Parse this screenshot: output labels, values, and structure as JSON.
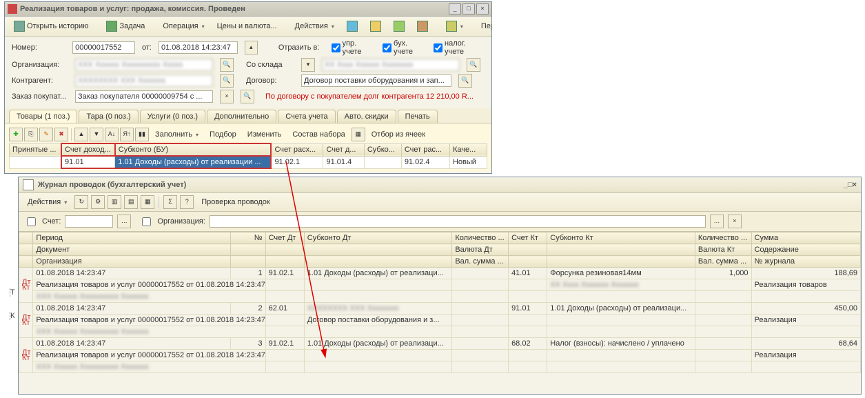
{
  "win1": {
    "title": "Реализация товаров и услуг: продажа, комиссия. Проведен",
    "tb": {
      "history": "Открыть историю",
      "task": "Задача",
      "operation": "Операция",
      "prices": "Цены и валюта...",
      "actions": "Действия",
      "goto": "Перейти"
    },
    "fields": {
      "number_lbl": "Номер:",
      "number": "00000017552",
      "from_lbl": "от:",
      "date": "01.08.2018 14:23:47",
      "reflect_lbl": "Отразить в:",
      "chk1": "упр. учете",
      "chk2": "бух. учете",
      "chk3": "налог. учете",
      "org_lbl": "Организация:",
      "warehouse_lbl": "Со склада",
      "contr_lbl": "Контрагент:",
      "contract_lbl": "Договор:",
      "contract": "Договор поставки оборудования и зап...",
      "order_lbl": "Заказ покупат...",
      "order": "Заказ покупателя 00000009754 с ...",
      "debt_note": "По договору с покупателем долг контрагента 12 210,00 R..."
    },
    "tabs": [
      "Товары (1 поз.)",
      "Тара (0 поз.)",
      "Услуги (0 поз.)",
      "Дополнительно",
      "Счета учета",
      "Авто. скидки",
      "Печать"
    ],
    "gtb": {
      "fill": "Заполнить",
      "select": "Подбор",
      "change": "Изменить",
      "bundle": "Состав набора",
      "cellfilter": "Отбор из ячеек"
    },
    "grid": {
      "headers": [
        "Принятые ...",
        "Счет доход...",
        "Субконто (БУ)",
        "Счет расх...",
        "Счет д...",
        "Субко...",
        "Счет рас...",
        "Каче..."
      ],
      "row": [
        "",
        "91.01",
        "1.01 Доходы (расходы) от реализации ...",
        "91.02.1",
        "91.01.4",
        "",
        "91.02.4",
        "Новый"
      ]
    }
  },
  "win2": {
    "title": "Журнал проводок (бухгалтерский учет)",
    "tb": {
      "actions": "Действия",
      "check": "Проверка проводок"
    },
    "filter": {
      "acct_lbl": "Счет:",
      "org_lbl": "Организация:"
    },
    "headers1": [
      "",
      "Период",
      "№",
      "Счет Дт",
      "Субконто Дт",
      "Количество ...",
      "Счет Кт",
      "Субконто Кт",
      "Количество ...",
      "Сумма"
    ],
    "headers2": [
      "",
      "Документ",
      "",
      "",
      "",
      "Валюта Дт",
      "",
      "",
      "Валюта Кт",
      "Содержание"
    ],
    "headers3": [
      "",
      "Организация",
      "",
      "",
      "",
      "Вал. сумма ...",
      "",
      "",
      "Вал. сумма ...",
      "№ журнала"
    ],
    "rows": [
      {
        "period": "01.08.2018 14:23:47",
        "n": "1",
        "dt": "91.02.1",
        "sdt": "1.01 Доходы (расходы) от реализаци...",
        "qdt": "",
        "kt": "41.01",
        "skt": "Форсунка  резиновая14мм",
        "qkt": "1,000",
        "sum": "188,69",
        "doc": "Реализация товаров и услуг 00000017552 от 01.08.2018 14:23:47",
        "cont": "Реализация товаров"
      },
      {
        "period": "01.08.2018 14:23:47",
        "n": "2",
        "dt": "62.01",
        "sdt": "[blur]",
        "qdt": "",
        "kt": "91.01",
        "skt": "1.01 Доходы (расходы) от реализаци...",
        "qkt": "",
        "sum": "450,00",
        "doc": "Реализация товаров и услуг 00000017552 от 01.08.2018 14:23:47",
        "sdt2": "Договор поставки оборудования и з...",
        "cont": "Реализация"
      },
      {
        "period": "01.08.2018 14:23:47",
        "n": "3",
        "dt": "91.02.1",
        "sdt": "1.01 Доходы (расходы) от реализаци...",
        "qdt": "",
        "kt": "68.02",
        "skt": "Налог (взносы): начислено / уплачено",
        "qkt": "",
        "sum": "68,64",
        "doc": "Реализация товаров и услуг 00000017552 от 01.08.2018 14:23:47",
        "cont": "Реализация"
      }
    ]
  }
}
